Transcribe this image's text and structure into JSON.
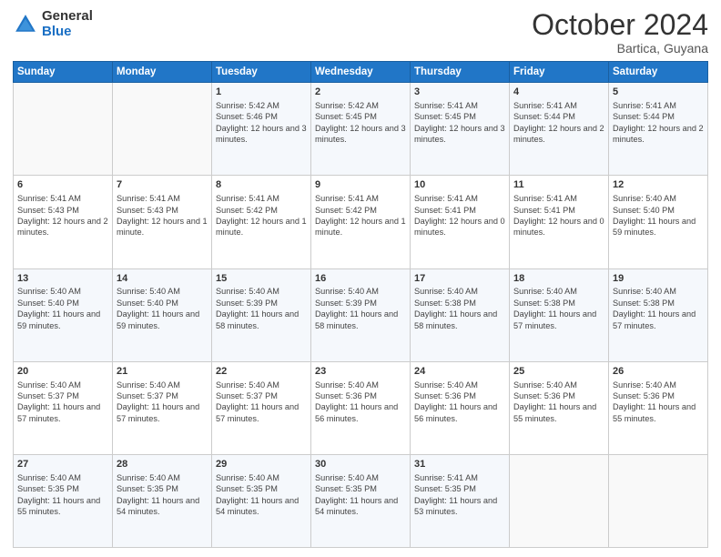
{
  "header": {
    "logo_line1": "General",
    "logo_line2": "Blue",
    "month": "October 2024",
    "location": "Bartica, Guyana"
  },
  "weekdays": [
    "Sunday",
    "Monday",
    "Tuesday",
    "Wednesday",
    "Thursday",
    "Friday",
    "Saturday"
  ],
  "weeks": [
    [
      {
        "day": "",
        "info": ""
      },
      {
        "day": "",
        "info": ""
      },
      {
        "day": "1",
        "info": "Sunrise: 5:42 AM\nSunset: 5:46 PM\nDaylight: 12 hours and 3 minutes."
      },
      {
        "day": "2",
        "info": "Sunrise: 5:42 AM\nSunset: 5:45 PM\nDaylight: 12 hours and 3 minutes."
      },
      {
        "day": "3",
        "info": "Sunrise: 5:41 AM\nSunset: 5:45 PM\nDaylight: 12 hours and 3 minutes."
      },
      {
        "day": "4",
        "info": "Sunrise: 5:41 AM\nSunset: 5:44 PM\nDaylight: 12 hours and 2 minutes."
      },
      {
        "day": "5",
        "info": "Sunrise: 5:41 AM\nSunset: 5:44 PM\nDaylight: 12 hours and 2 minutes."
      }
    ],
    [
      {
        "day": "6",
        "info": "Sunrise: 5:41 AM\nSunset: 5:43 PM\nDaylight: 12 hours and 2 minutes."
      },
      {
        "day": "7",
        "info": "Sunrise: 5:41 AM\nSunset: 5:43 PM\nDaylight: 12 hours and 1 minute."
      },
      {
        "day": "8",
        "info": "Sunrise: 5:41 AM\nSunset: 5:42 PM\nDaylight: 12 hours and 1 minute."
      },
      {
        "day": "9",
        "info": "Sunrise: 5:41 AM\nSunset: 5:42 PM\nDaylight: 12 hours and 1 minute."
      },
      {
        "day": "10",
        "info": "Sunrise: 5:41 AM\nSunset: 5:41 PM\nDaylight: 12 hours and 0 minutes."
      },
      {
        "day": "11",
        "info": "Sunrise: 5:41 AM\nSunset: 5:41 PM\nDaylight: 12 hours and 0 minutes."
      },
      {
        "day": "12",
        "info": "Sunrise: 5:40 AM\nSunset: 5:40 PM\nDaylight: 11 hours and 59 minutes."
      }
    ],
    [
      {
        "day": "13",
        "info": "Sunrise: 5:40 AM\nSunset: 5:40 PM\nDaylight: 11 hours and 59 minutes."
      },
      {
        "day": "14",
        "info": "Sunrise: 5:40 AM\nSunset: 5:40 PM\nDaylight: 11 hours and 59 minutes."
      },
      {
        "day": "15",
        "info": "Sunrise: 5:40 AM\nSunset: 5:39 PM\nDaylight: 11 hours and 58 minutes."
      },
      {
        "day": "16",
        "info": "Sunrise: 5:40 AM\nSunset: 5:39 PM\nDaylight: 11 hours and 58 minutes."
      },
      {
        "day": "17",
        "info": "Sunrise: 5:40 AM\nSunset: 5:38 PM\nDaylight: 11 hours and 58 minutes."
      },
      {
        "day": "18",
        "info": "Sunrise: 5:40 AM\nSunset: 5:38 PM\nDaylight: 11 hours and 57 minutes."
      },
      {
        "day": "19",
        "info": "Sunrise: 5:40 AM\nSunset: 5:38 PM\nDaylight: 11 hours and 57 minutes."
      }
    ],
    [
      {
        "day": "20",
        "info": "Sunrise: 5:40 AM\nSunset: 5:37 PM\nDaylight: 11 hours and 57 minutes."
      },
      {
        "day": "21",
        "info": "Sunrise: 5:40 AM\nSunset: 5:37 PM\nDaylight: 11 hours and 57 minutes."
      },
      {
        "day": "22",
        "info": "Sunrise: 5:40 AM\nSunset: 5:37 PM\nDaylight: 11 hours and 57 minutes."
      },
      {
        "day": "23",
        "info": "Sunrise: 5:40 AM\nSunset: 5:36 PM\nDaylight: 11 hours and 56 minutes."
      },
      {
        "day": "24",
        "info": "Sunrise: 5:40 AM\nSunset: 5:36 PM\nDaylight: 11 hours and 56 minutes."
      },
      {
        "day": "25",
        "info": "Sunrise: 5:40 AM\nSunset: 5:36 PM\nDaylight: 11 hours and 55 minutes."
      },
      {
        "day": "26",
        "info": "Sunrise: 5:40 AM\nSunset: 5:36 PM\nDaylight: 11 hours and 55 minutes."
      }
    ],
    [
      {
        "day": "27",
        "info": "Sunrise: 5:40 AM\nSunset: 5:35 PM\nDaylight: 11 hours and 55 minutes."
      },
      {
        "day": "28",
        "info": "Sunrise: 5:40 AM\nSunset: 5:35 PM\nDaylight: 11 hours and 54 minutes."
      },
      {
        "day": "29",
        "info": "Sunrise: 5:40 AM\nSunset: 5:35 PM\nDaylight: 11 hours and 54 minutes."
      },
      {
        "day": "30",
        "info": "Sunrise: 5:40 AM\nSunset: 5:35 PM\nDaylight: 11 hours and 54 minutes."
      },
      {
        "day": "31",
        "info": "Sunrise: 5:41 AM\nSunset: 5:35 PM\nDaylight: 11 hours and 53 minutes."
      },
      {
        "day": "",
        "info": ""
      },
      {
        "day": "",
        "info": ""
      }
    ]
  ]
}
